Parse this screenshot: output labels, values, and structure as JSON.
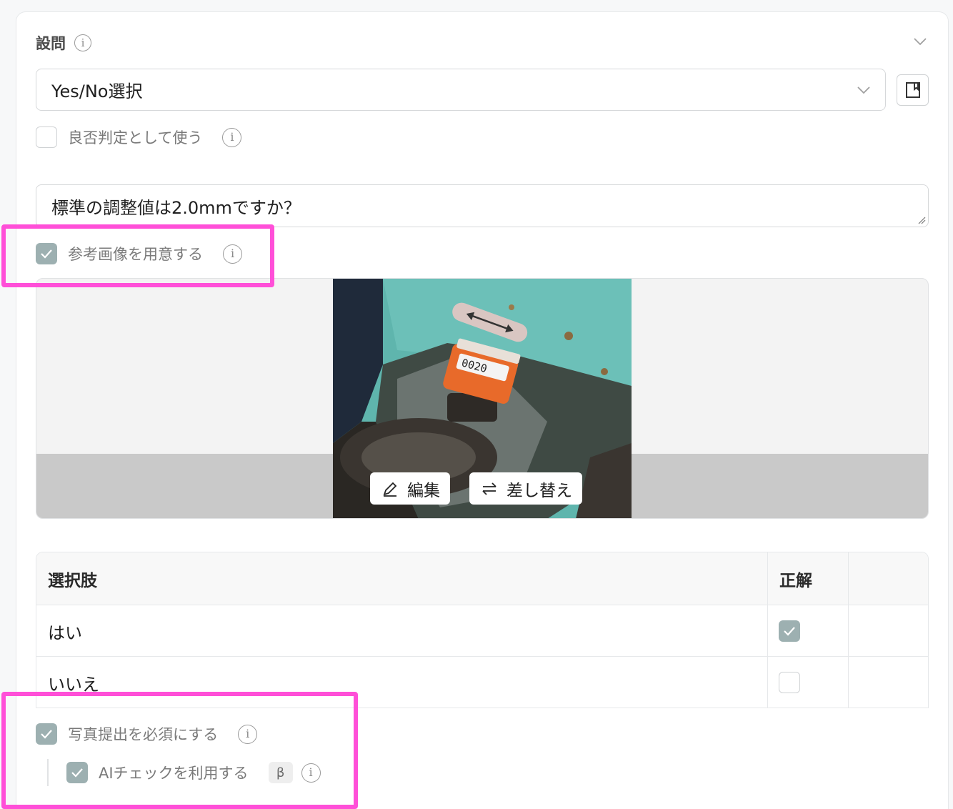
{
  "section": {
    "title": "設問",
    "icons": {
      "info": "info-icon",
      "collapse": "chevron-down-icon"
    }
  },
  "question_type": {
    "selected": "Yes/No選択",
    "icon": "chevron-down-icon"
  },
  "bookmark": {
    "icon": "bookmark-icon"
  },
  "pass_fail": {
    "label": "良否判定として使う",
    "checked": false
  },
  "question_text": {
    "value": "標準の調整値は2.0mmですか？"
  },
  "reference_image": {
    "label": "参考画像を用意する",
    "checked": true,
    "photo_icon": "meter-photo",
    "edit_label": "編集",
    "replace_label": "差し替え"
  },
  "choices": {
    "headers": {
      "option": "選択肢",
      "correct": "正解"
    },
    "rows": [
      {
        "label": "はい",
        "correct": true
      },
      {
        "label": "いいえ",
        "correct": false
      }
    ]
  },
  "photo_required": {
    "label": "写真提出を必須にする",
    "checked": true
  },
  "ai_check": {
    "label": "AIチェックを利用する",
    "badge": "β",
    "checked": true
  },
  "colors": {
    "highlight": "#ff4fd8",
    "checkbox_checked": "#9db0b1"
  }
}
